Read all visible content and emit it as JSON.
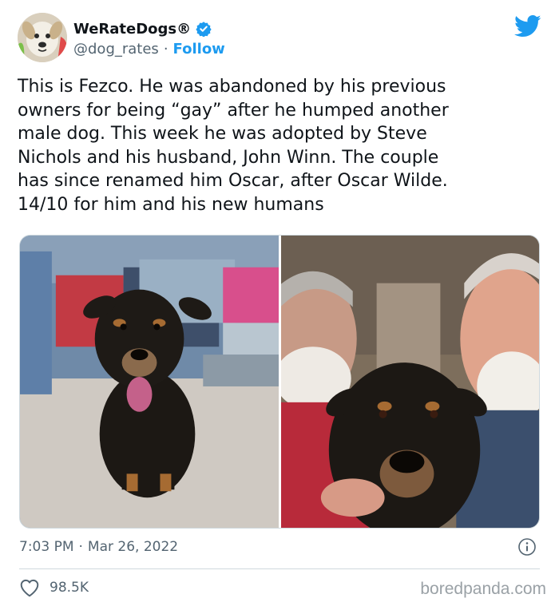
{
  "author": {
    "display_name": "WeRateDogs®",
    "handle": "@dog_rates",
    "separator": "·",
    "follow_label": "Follow"
  },
  "icons": {
    "verified": "verified-badge-icon",
    "brand": "twitter-bird-icon",
    "info": "info-icon",
    "like": "heart-icon"
  },
  "tweet": {
    "text": "This is Fezco. He was abandoned by his previous\nowners for being “gay” after he humped another\nmale dog. This week he was adopted by Steve\nNichols and his husband, John Winn. The couple\nhas since renamed him Oscar, after Oscar Wilde.\n14/10 for him and his new humans",
    "time": "7:03 PM",
    "separator": "·",
    "date": "Mar 26, 2022",
    "like_count": "98.5K"
  },
  "watermark": "boredpanda.com",
  "colors": {
    "accent": "#1d9bf0",
    "text": "#0f1419",
    "muted": "#536471",
    "border": "#cfd9de"
  }
}
